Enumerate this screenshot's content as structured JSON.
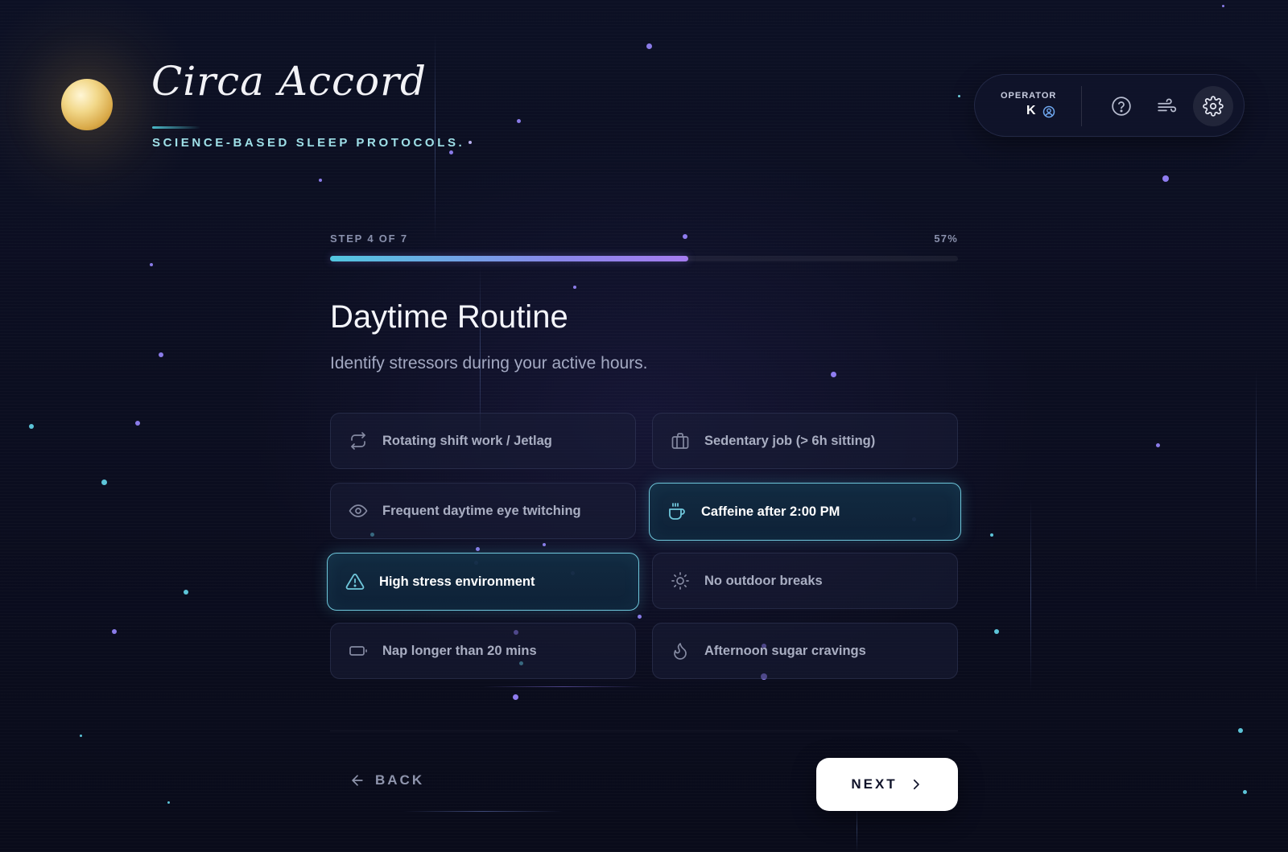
{
  "brand": {
    "title": "Circa Accord",
    "tagline": "SCIENCE-BASED SLEEP PROTOCOLS."
  },
  "operator": {
    "label": "OPERATOR",
    "name": "K",
    "icons": [
      "user-circle-icon",
      "help-circle-icon",
      "wind-icon",
      "gear-icon"
    ]
  },
  "progress": {
    "step_text": "STEP 4 OF 7",
    "percent_text": "57%",
    "fraction": 0.57
  },
  "page": {
    "title": "Daytime Routine",
    "subtitle": "Identify stressors during your active hours."
  },
  "options": [
    {
      "label": "Rotating shift work / Jetlag",
      "icon": "repeat-icon",
      "selected": false
    },
    {
      "label": "Sedentary job (> 6h sitting)",
      "icon": "briefcase-icon",
      "selected": false
    },
    {
      "label": "Frequent daytime eye twitching",
      "icon": "eye-icon",
      "selected": false
    },
    {
      "label": "Caffeine after 2:00 PM",
      "icon": "coffee-icon",
      "selected": true
    },
    {
      "label": "High stress environment",
      "icon": "warning-triangle-icon",
      "selected": true
    },
    {
      "label": "No outdoor breaks",
      "icon": "sun-icon",
      "selected": false
    },
    {
      "label": "Nap longer than 20 mins",
      "icon": "battery-icon",
      "selected": false
    },
    {
      "label": "Afternoon sugar cravings",
      "icon": "flame-icon",
      "selected": false
    }
  ],
  "nav": {
    "back_label": "BACK",
    "next_label": "NEXT"
  },
  "colors": {
    "accent": "#6fc7db",
    "progress_start": "#52c6e0",
    "progress_end": "#a57cf0",
    "background": "#0b0e20"
  }
}
